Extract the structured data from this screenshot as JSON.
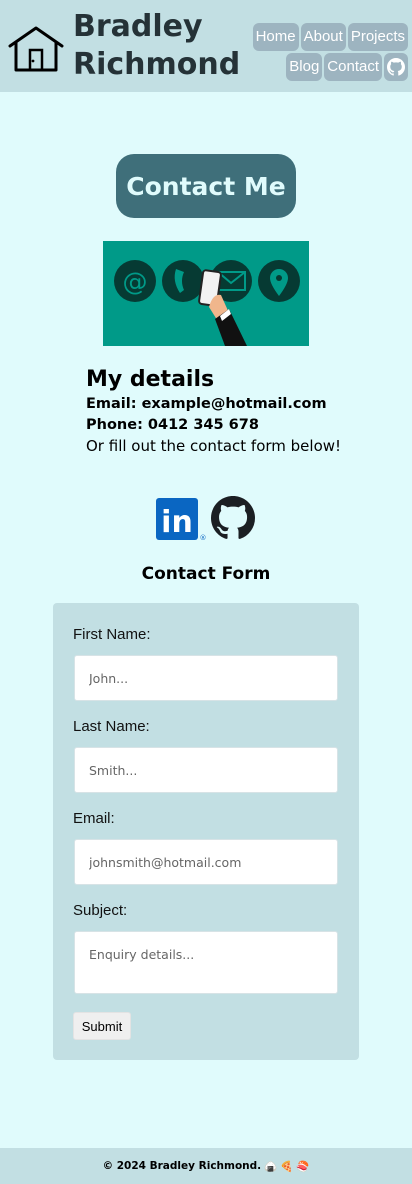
{
  "header": {
    "site_name_line1": "Bradley",
    "site_name_line2": "Richmond",
    "logo_icon": "house-icon",
    "nav": [
      "Home",
      "About",
      "Projects",
      "Blog",
      "Contact"
    ],
    "nav_github_icon": "github-icon"
  },
  "main": {
    "title": "Contact Me",
    "hero_image": "contact-illustration",
    "details": {
      "heading": "My details",
      "email": "Email: example@hotmail.com",
      "phone": "Phone: 0412 345 678",
      "note": "Or fill out the contact form below!"
    },
    "socials": [
      {
        "icon": "linkedin-icon",
        "text": "in"
      },
      {
        "icon": "github-icon"
      }
    ]
  },
  "form": {
    "heading": "Contact Form",
    "first_name_label": "First Name:",
    "first_name_placeholder": "John...",
    "last_name_label": "Last Name:",
    "last_name_placeholder": "Smith...",
    "email_label": "Email:",
    "email_placeholder": "johnsmith@hotmail.com",
    "subject_label": "Subject:",
    "subject_placeholder": "Enquiry details...",
    "submit_label": "Submit"
  },
  "footer": {
    "copyright": "© 2024 Bradley Richmond.",
    "emojis": [
      "🍙",
      "🍕",
      "🍣"
    ]
  },
  "colors": {
    "page_bg": "#e0fbfc",
    "header_bg": "#c2dfe3",
    "nav_bg": "#9db4c0",
    "title_bg": "#3f6f7a",
    "text_dark": "#253237"
  }
}
